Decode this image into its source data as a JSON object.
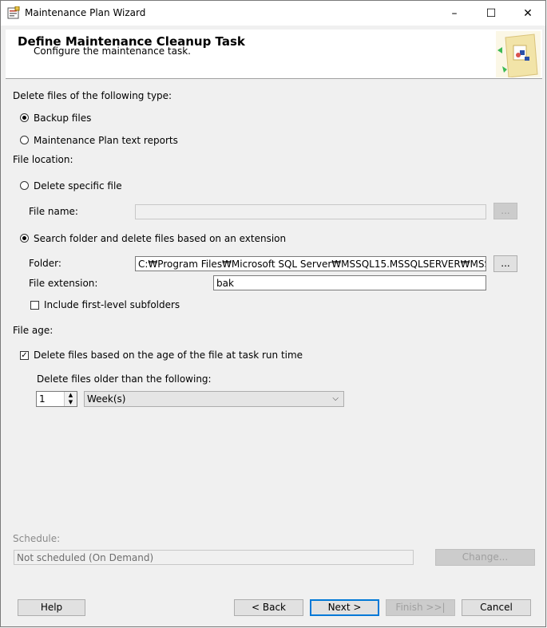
{
  "window": {
    "title": "Maintenance Plan Wizard",
    "minimize": "–",
    "maximize": "☐",
    "close": "✕"
  },
  "header": {
    "title": "Define Maintenance Cleanup Task",
    "subtitle": "Configure the maintenance task."
  },
  "file_type": {
    "label": "Delete files of the following type:",
    "options": [
      {
        "label": "Backup files",
        "selected": true
      },
      {
        "label": "Maintenance Plan text reports",
        "selected": false
      }
    ]
  },
  "file_location": {
    "label": "File location:",
    "delete_specific": {
      "label": "Delete specific file",
      "selected": false
    },
    "file_name_label": "File name:",
    "file_name_value": "",
    "browse_label": "...",
    "search_folder": {
      "label": "Search folder and delete files based on an extension",
      "selected": true
    },
    "folder_label": "Folder:",
    "folder_value": "C:₩Program Files₩Microsoft SQL Server₩MSSQL15.MSSQLSERVER₩MSS",
    "file_extension_label": "File extension:",
    "file_extension_value": "bak",
    "include_subfolders": {
      "label": "Include first-level subfolders",
      "checked": false
    }
  },
  "file_age": {
    "label": "File age:",
    "delete_by_age": {
      "label": "Delete files based on the age of the file at task run time",
      "checked": true
    },
    "older_than_label": "Delete files older than the following:",
    "amount_value": "1",
    "unit_value": "Week(s)"
  },
  "schedule": {
    "label": "Schedule:",
    "value": "Not scheduled (On Demand)",
    "change_label": "Change..."
  },
  "footer": {
    "help": "Help",
    "back": "< Back",
    "next": "Next >",
    "finish": "Finish >>|",
    "cancel": "Cancel"
  }
}
